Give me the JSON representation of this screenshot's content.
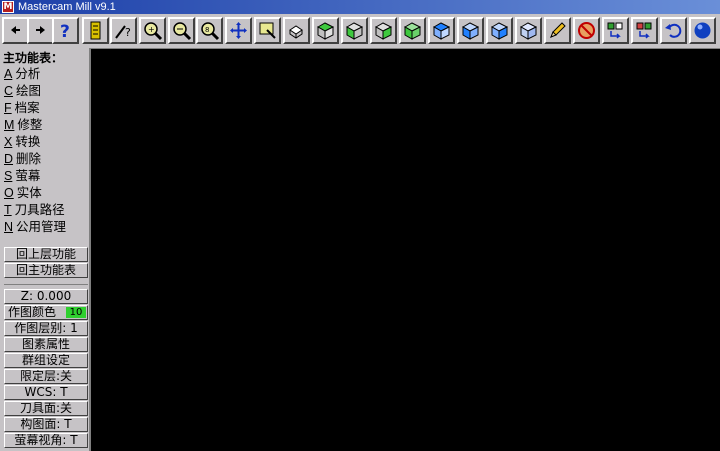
{
  "window": {
    "title": "Mastercam Mill v9.1",
    "app_icon_glyph": "M"
  },
  "toolbar": {
    "buttons": [
      {
        "name": "arrow-left-icon"
      },
      {
        "name": "arrow-right-icon"
      },
      {
        "name": "help-icon"
      },
      {
        "name": "notepad-icon"
      },
      {
        "name": "analyze-icon"
      },
      {
        "name": "zoom-in-icon"
      },
      {
        "name": "zoom-out-icon"
      },
      {
        "name": "zoom-half-icon"
      },
      {
        "name": "pan-icon"
      },
      {
        "name": "window-zoom-icon"
      },
      {
        "name": "rotate-view-icon"
      },
      {
        "name": "cube-top-icon"
      },
      {
        "name": "cube-front-icon"
      },
      {
        "name": "cube-side-icon"
      },
      {
        "name": "cube-iso-icon"
      },
      {
        "name": "cube-blue-1-icon"
      },
      {
        "name": "cube-blue-2-icon"
      },
      {
        "name": "cube-blue-3-icon"
      },
      {
        "name": "cube-blue-4-icon"
      },
      {
        "name": "pencil-icon"
      },
      {
        "name": "no-entry-icon"
      },
      {
        "name": "transform-1-icon"
      },
      {
        "name": "transform-2-icon"
      },
      {
        "name": "undo-icon"
      },
      {
        "name": "sphere-icon"
      }
    ]
  },
  "panel": {
    "title": "主功能表：",
    "menu": [
      {
        "key": "A",
        "label": "分析"
      },
      {
        "key": "C",
        "label": "绘图"
      },
      {
        "key": "F",
        "label": "档案"
      },
      {
        "key": "M",
        "label": "修整"
      },
      {
        "key": "X",
        "label": "转换"
      },
      {
        "key": "D",
        "label": "删除"
      },
      {
        "key": "S",
        "label": "萤幕"
      },
      {
        "key": "O",
        "label": "实体"
      },
      {
        "key": "T",
        "label": "刀具路径"
      },
      {
        "key": "N",
        "label": "公用管理"
      }
    ],
    "back_up": "回上层功能",
    "back_main": "回主功能表",
    "z_value": "Z:  0.000",
    "draw_color_label": "作图颜色",
    "draw_color_value": "10",
    "draw_color_hex": "#2fd02f",
    "draw_level": "作图层别:  1",
    "entity_attr": "图素属性",
    "group_setting": "群组设定",
    "mask_level": "限定层:关",
    "wcs": "WCS:   T",
    "tool_plane": "刀具面:关",
    "construction_plane": "构图面:  T",
    "screen_view": "萤幕视角:  T"
  },
  "colors": {
    "toolbar_bg": "#c6c3c6",
    "canvas_bg": "#000000"
  }
}
